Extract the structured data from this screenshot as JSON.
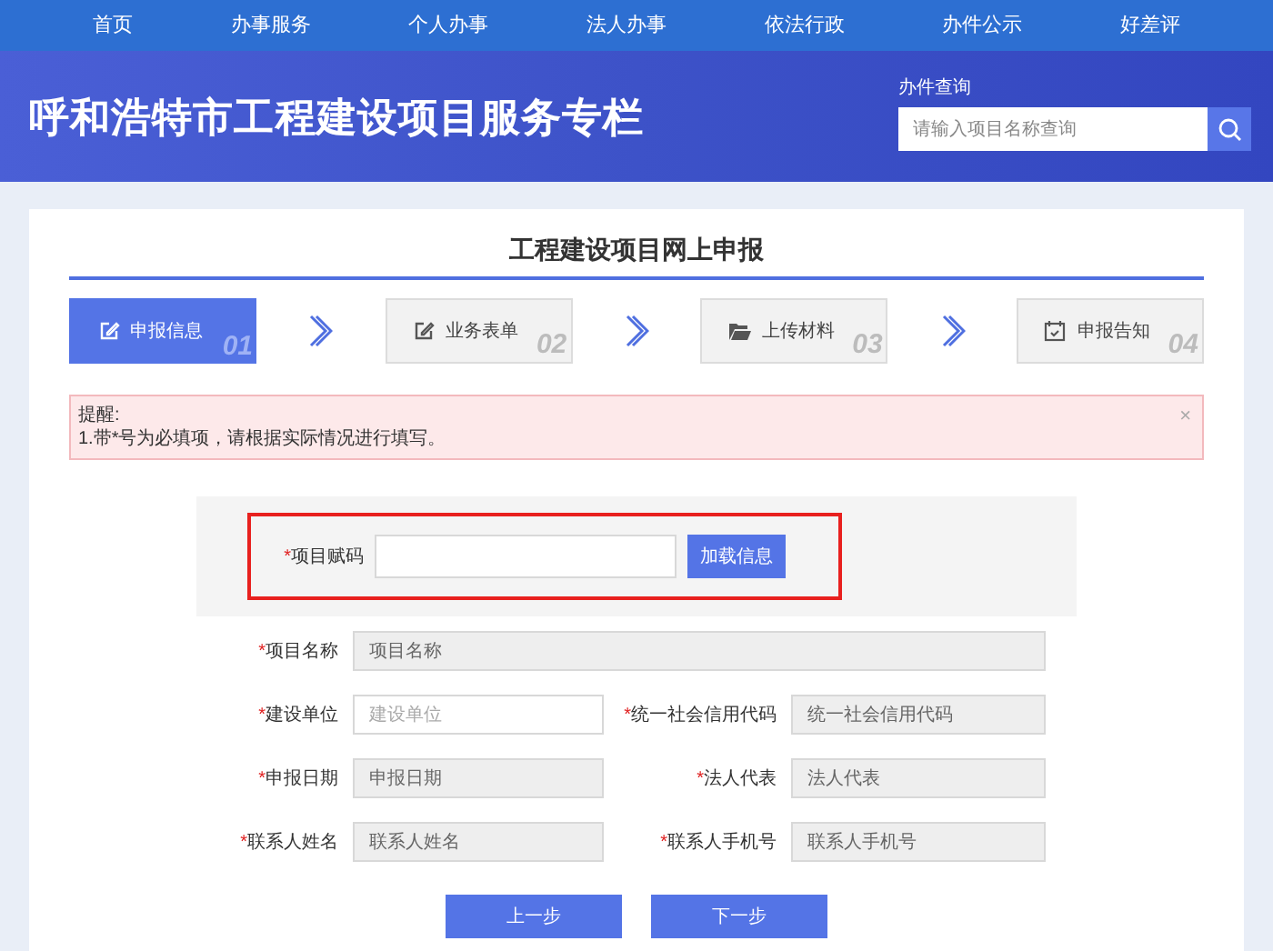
{
  "nav": [
    {
      "label": "首页",
      "selected": false
    },
    {
      "label": "办事服务",
      "selected": false
    },
    {
      "label": "个人办事",
      "selected": false
    },
    {
      "label": "法人办事",
      "selected": false
    },
    {
      "label": "依法行政",
      "selected": false
    },
    {
      "label": "办件公示",
      "selected": false
    },
    {
      "label": "好差评",
      "selected": false
    }
  ],
  "banner": {
    "title": "呼和浩特市工程建设项目服务专栏",
    "search_label": "办件查询",
    "search": {
      "placeholder": "请输入项目名称查询"
    }
  },
  "form_title": "工程建设项目网上申报",
  "steps": [
    {
      "label": "申报信息",
      "number": "01",
      "kind": "edit",
      "selected": true
    },
    {
      "label": "业务表单",
      "number": "02",
      "kind": "edit",
      "selected": false
    },
    {
      "label": "上传材料",
      "number": "03",
      "kind": "folder",
      "selected": false
    },
    {
      "label": "申报告知",
      "number": "04",
      "kind": "calendar",
      "selected": false
    }
  ],
  "alert": {
    "title": "提醒:",
    "text": "1.带*号为必填项，请根据实际情况进行填写。",
    "close": "×"
  },
  "code": {
    "mark": "*",
    "label": "项目赋码",
    "button": "加载信息"
  },
  "fields": [
    {
      "mark": "*",
      "label": "项目名称",
      "placeholder": "项目名称",
      "disabled": true
    },
    {
      "mark": "*",
      "label": "建设单位",
      "placeholder": "建设单位",
      "disabled": false
    },
    {
      "mark": "*",
      "label": "统一社会信用代码",
      "placeholder": "统一社会信用代码",
      "disabled": true
    },
    {
      "mark": "*",
      "label": "申报日期",
      "placeholder": "申报日期",
      "disabled": true
    },
    {
      "mark": "*",
      "label": "法人代表",
      "placeholder": "法人代表",
      "disabled": true
    },
    {
      "mark": "*",
      "label": "联系人姓名",
      "placeholder": "联系人姓名",
      "disabled": true
    },
    {
      "mark": "*",
      "label": "联系人手机号",
      "placeholder": "联系人手机号",
      "disabled": true
    }
  ],
  "buttons": [
    "上一步",
    "下一步"
  ]
}
